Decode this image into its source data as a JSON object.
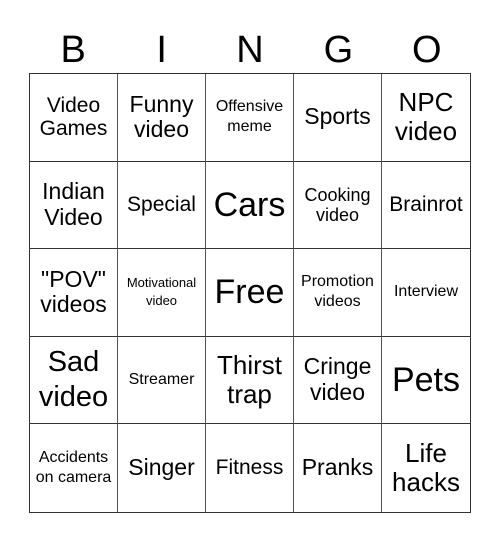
{
  "header": [
    "B",
    "I",
    "N",
    "G",
    "O"
  ],
  "cells": [
    [
      "Video Games",
      "Funny video",
      "Offensive meme",
      "Sports",
      "NPC video"
    ],
    [
      "Indian Video",
      "Special",
      "Cars",
      "Cooking video",
      "Brainrot"
    ],
    [
      "\"POV\" videos",
      "Motivational video",
      "Free",
      "Promotion videos",
      "Interview"
    ],
    [
      "Sad video",
      "Streamer",
      "Thirst trap",
      "Cringe video",
      "Pets"
    ],
    [
      "Accidents on camera",
      "Singer",
      "Fitness",
      "Pranks",
      "Life hacks"
    ]
  ]
}
